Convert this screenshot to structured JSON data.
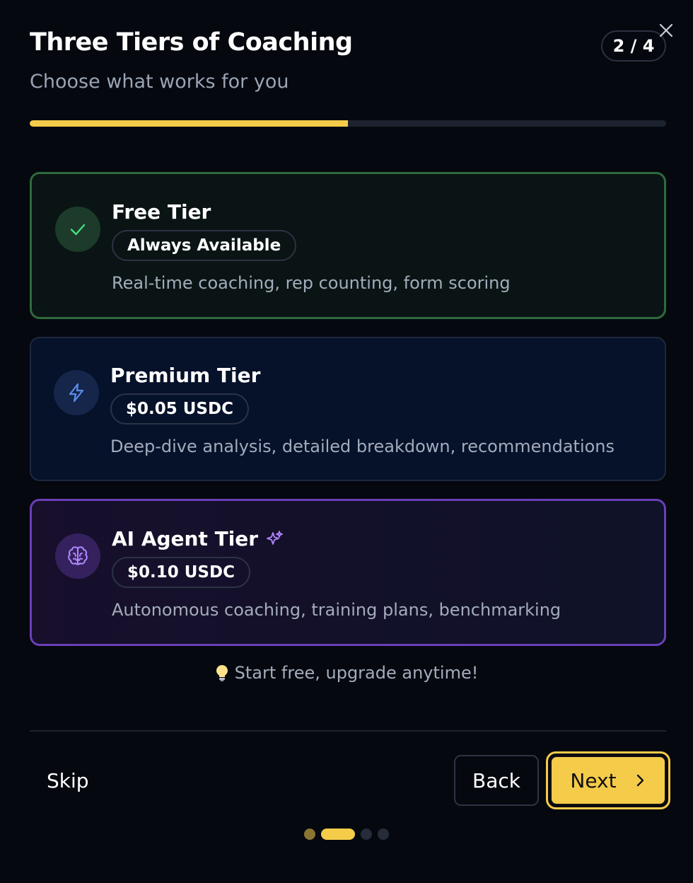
{
  "header": {
    "title": "Three Tiers of Coaching",
    "subtitle": "Choose what works for you",
    "step_label": "2 / 4",
    "close_icon": "close-icon"
  },
  "progress": {
    "current_step": 2,
    "total_steps": 4,
    "fraction": 0.5,
    "color": "#f5cc4a"
  },
  "tiers": [
    {
      "name": "Free Tier",
      "pill": "Always Available",
      "description": "Real-time coaching, rep counting, form scoring",
      "icon": "check-icon",
      "accent": "#4ade80"
    },
    {
      "name": "Premium Tier",
      "pill": "$0.05 USDC",
      "description": "Deep-dive analysis, detailed breakdown, recommendations",
      "icon": "lightning-icon",
      "accent": "#5b8def"
    },
    {
      "name": "AI Agent Tier",
      "pill": "$0.10 USDC",
      "description": "Autonomous coaching, training plans, benchmarking",
      "icon": "brain-icon",
      "accent": "#b388ff",
      "badge_icon": "sparkles-icon"
    }
  ],
  "tip": {
    "icon": "lightbulb-icon",
    "text": "Start free, upgrade anytime!"
  },
  "footer": {
    "skip_label": "Skip",
    "back_label": "Back",
    "next_label": "Next",
    "next_icon": "chevron-right-icon"
  },
  "pagination": {
    "count": 4,
    "current_index": 1
  }
}
